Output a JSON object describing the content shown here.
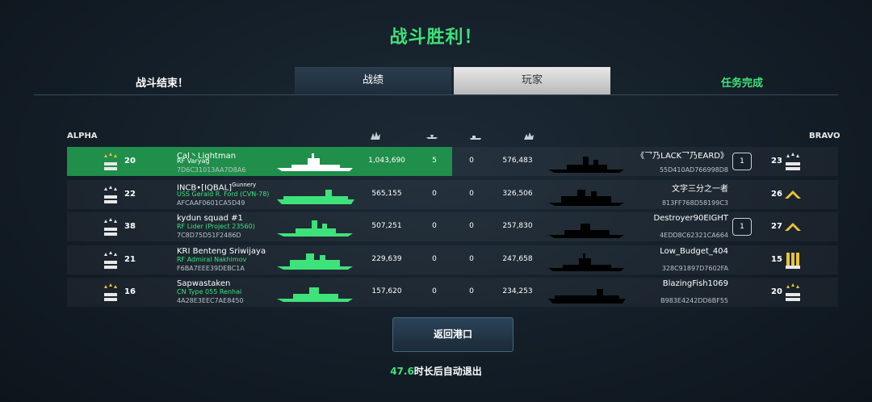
{
  "header": {
    "title": "战斗胜利！",
    "left_label": "战斗结束！",
    "tabs": [
      "战绩",
      "玩家"
    ],
    "active_tab": "玩家",
    "right_label": "任务完成"
  },
  "teams": {
    "left": "ALPHA",
    "right": "BRAVO"
  },
  "columns_icons": [
    "damage-icon",
    "plane-icon",
    "submarine-icon",
    "damage-taken-icon"
  ],
  "players_left": [
    {
      "name": "Cal丶Lightman",
      "ship": "RF Varyag",
      "id": "7D6C31013AA7D8A6",
      "level": "20",
      "damage": "1,043,690",
      "kills": "5",
      "assists": "0",
      "received": "576,483",
      "rank_icon": "gold-stars-insignia"
    },
    {
      "name": "INCB•[IQBAL]",
      "name_sup": "Gunnery",
      "ship": "USS Gerald R. Ford (CVN-78)",
      "id": "AFCAAF0601CA5D49",
      "level": "22",
      "damage": "565,155",
      "kills": "0",
      "assists": "0",
      "received": "326,506",
      "rank_icon": "two-stars-insignia"
    },
    {
      "name": "kydun squad #1",
      "ship": "RF Lider (Project 23560)",
      "id": "7C8D75D51F2486D",
      "level": "38",
      "damage": "507,251",
      "kills": "0",
      "assists": "0",
      "received": "257,830",
      "rank_icon": "bar-insignia"
    },
    {
      "name": "KRI Benteng Sriwijaya",
      "ship": "RF Admiral Nakhimov",
      "id": "F6BA7EEE39DEBC1A",
      "level": "21",
      "damage": "229,639",
      "kills": "0",
      "assists": "0",
      "received": "247,658",
      "rank_icon": "star-wings-insignia"
    },
    {
      "name": "Sapwastaken",
      "ship": "CN Type 055 Renhai",
      "id": "4A28E3EEC7AE8450",
      "level": "16",
      "damage": "157,620",
      "kills": "0",
      "assists": "0",
      "received": "234,253",
      "rank_icon": "gold-chevrons-insignia"
    }
  ],
  "players_right": [
    {
      "name": "《乛乃LACK乛乃EARD》",
      "id": "55D410AD766998D8",
      "badge": "1",
      "level": "23",
      "rank_icon": "three-stars-insignia"
    },
    {
      "name": "文字三分之一者",
      "id": "813FF768D58199C3",
      "badge": "",
      "level": "26",
      "rank_icon": "gold-chevron-insignia"
    },
    {
      "name": "Destroyer90EIGHT",
      "id": "4EDD8C62321CA664",
      "badge": "1",
      "level": "27",
      "rank_icon": "chevron-star-insignia"
    },
    {
      "name": "Low_Budget_404",
      "id": "328C91897D7602FA",
      "badge": "",
      "level": "15",
      "rank_icon": "gold-chevrons-insignia"
    },
    {
      "name": "BlazingFish1069",
      "id": "B983E4242DD6BF55",
      "badge": "",
      "level": "20",
      "rank_icon": "gold-stars-insignia"
    }
  ],
  "footer": {
    "button": "返回港口",
    "countdown": "47.6",
    "countdown_text": "时长后自动退出"
  },
  "colors": {
    "accent_green": "#3ee27a",
    "highlight_row": "#1f8f4b"
  }
}
